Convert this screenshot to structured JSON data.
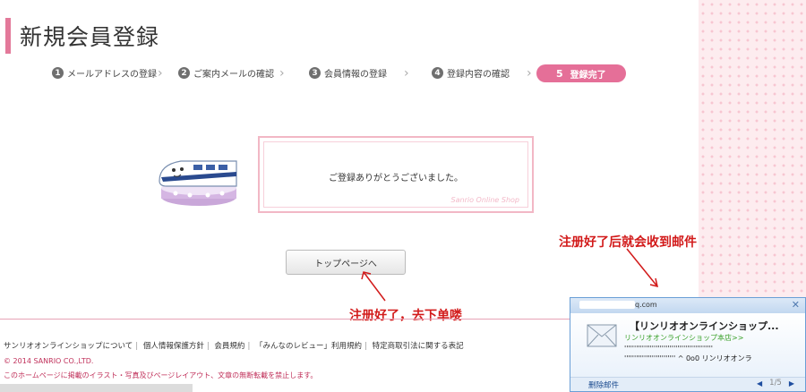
{
  "page": {
    "title": "新規会員登録"
  },
  "steps": [
    {
      "num": "1",
      "label": "メールアドレスの登録"
    },
    {
      "num": "2",
      "label": "ご案内メールの確認"
    },
    {
      "num": "3",
      "label": "会員情報の登録"
    },
    {
      "num": "4",
      "label": "登録内容の確認"
    },
    {
      "num": "5",
      "label": "登録完了"
    }
  ],
  "notice": {
    "text": "ご登録ありがとうございました。",
    "watermark": "Sanrio Online Shop"
  },
  "top_button": {
    "label": "トップページへ"
  },
  "annotations": {
    "mail_note": "注册好了后就会收到邮件",
    "order_note": "注册好了，去下单喽"
  },
  "footer": {
    "links": [
      "サンリオオンラインショップについて",
      "個人情報保護方針",
      "会員規約",
      "「みんなのレビュー」利用規約",
      "特定商取引法に関する表記"
    ],
    "copyright": "© 2014 SANRIO CO.,LTD.",
    "note": "このホームページに掲載のイラスト・写真及びページレイアウト、文章の無断転載を禁止します。"
  },
  "popup": {
    "email_suffix": "q.com",
    "subject": "【リンリオオンラインショップ...",
    "from": "リンリオオンラインショップ本店>>",
    "preview_line1": "'''''''''''''''''''''''''''''''''''''''''''''",
    "preview_line2": "''''''''''''''''''''''''''  ^ 0o0      リンリオオンラ",
    "delete_label": "删除邮件",
    "page_indicator": "1/5"
  },
  "colors": {
    "accent_pink": "#e56f98",
    "annotation_red": "#d21a1a",
    "popup_border": "#6a9fd6"
  }
}
